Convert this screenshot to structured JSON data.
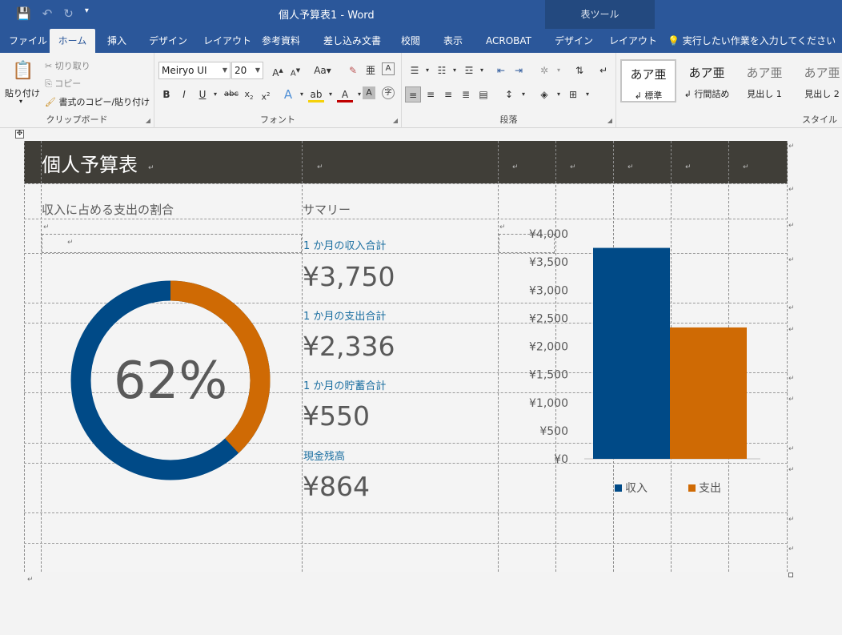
{
  "window": {
    "title": "個人予算表1 - Word",
    "context_group": "表ツール"
  },
  "tabs": [
    {
      "label": "ファイル",
      "active": false
    },
    {
      "label": "ホーム",
      "active": true
    },
    {
      "label": "挿入",
      "active": false
    },
    {
      "label": "デザイン",
      "active": false
    },
    {
      "label": "レイアウト",
      "active": false
    },
    {
      "label": "参考資料",
      "active": false
    },
    {
      "label": "差し込み文書",
      "active": false
    },
    {
      "label": "校閲",
      "active": false
    },
    {
      "label": "表示",
      "active": false
    },
    {
      "label": "ACROBAT",
      "active": false
    },
    {
      "label": "デザイン",
      "active": false
    },
    {
      "label": "レイアウト",
      "active": false
    }
  ],
  "tell_me": "実行したい作業を入力してください",
  "clipboard": {
    "paste": "貼り付け",
    "cut": "切り取り",
    "copy": "コピー",
    "format_painter": "書式のコピー/貼り付け",
    "group_label": "クリップボード"
  },
  "font": {
    "name": "Meiryo UI",
    "size": "20",
    "group_label": "フォント"
  },
  "paragraph": {
    "group_label": "段落"
  },
  "styles": {
    "group_label": "スタイル",
    "items": [
      {
        "sample": "あア亜",
        "name": "標準"
      },
      {
        "sample": "あア亜",
        "name": "行間詰め"
      },
      {
        "sample": "あア亜",
        "name": "見出し 1"
      },
      {
        "sample": "あア亜",
        "name": "見出し 2"
      }
    ]
  },
  "document": {
    "title": "個人予算表",
    "left_heading": "収入に占める支出の割合",
    "summary_heading": "サマリー",
    "donut_percent": "62%",
    "donut_value": 0.62,
    "summary": [
      {
        "label": "1 か月の収入合計",
        "value": "¥3,750"
      },
      {
        "label": "1 か月の支出合計",
        "value": "¥2,336"
      },
      {
        "label": "1 か月の貯蓄合計",
        "value": "¥550"
      },
      {
        "label": "現金残高",
        "value": "¥864"
      }
    ]
  },
  "colors": {
    "income": "#004a87",
    "expense": "#cf6a04",
    "header": "#403e38"
  },
  "chart_data": {
    "type": "bar",
    "categories": [
      ""
    ],
    "series": [
      {
        "name": "収入",
        "values": [
          3750
        ]
      },
      {
        "name": "支出",
        "values": [
          2336
        ]
      }
    ],
    "ylim": [
      0,
      4000
    ],
    "yticks": [
      "¥0",
      "¥500",
      "¥1,000",
      "¥1,500",
      "¥2,000",
      "¥2,500",
      "¥3,000",
      "¥3,500",
      "¥4,000"
    ],
    "legend": "bottom",
    "grid": false
  }
}
